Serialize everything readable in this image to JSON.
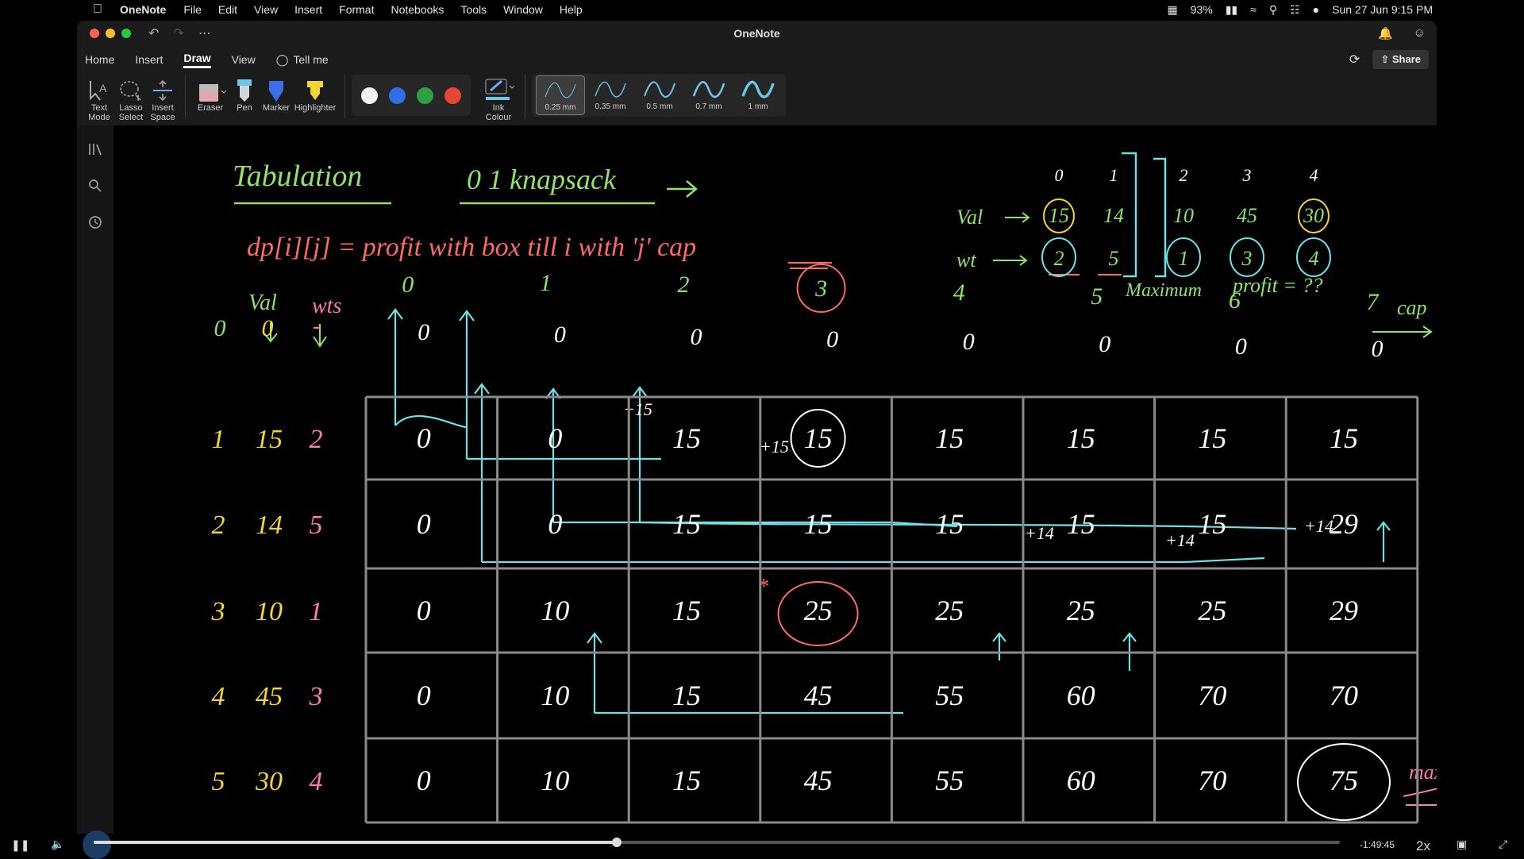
{
  "menubar": {
    "app_name": "OneNote",
    "items": [
      "File",
      "Edit",
      "View",
      "Insert",
      "Format",
      "Notebooks",
      "Tools",
      "Window",
      "Help"
    ],
    "battery": "93%",
    "datetime": "Sun 27 Jun  9:15 PM"
  },
  "window": {
    "title": "OneNote",
    "tabs": [
      "Home",
      "Insert",
      "Draw",
      "View"
    ],
    "active_tab": "Draw",
    "tell_me": "Tell me",
    "share": "Share"
  },
  "ribbon": {
    "text_mode": [
      "Text",
      "Mode"
    ],
    "lasso_select": [
      "Lasso",
      "Select"
    ],
    "insert_space": [
      "Insert",
      "Space"
    ],
    "eraser": "Eraser",
    "pen": "Pen",
    "marker": "Marker",
    "highlighter": "Highlighter",
    "ink_colour": [
      "Ink",
      "Colour"
    ],
    "colors": [
      "#f2f2f2",
      "#2f6fe6",
      "#2ea043",
      "#e8472f"
    ],
    "pen_widths": [
      "0.25 mm",
      "0.35 mm",
      "0.5 mm",
      "0.7 mm",
      "1 mm"
    ],
    "selected_width": "0.25 mm"
  },
  "note": {
    "heading": "Tabulation",
    "subheading": "0 1 knapsack",
    "definition": "dp[i][j] = profit with box till i with 'j' cap",
    "items_panel": {
      "indices": [
        "0",
        "1",
        "2",
        "3",
        "4"
      ],
      "val_label": "Val",
      "wt_label": "wt",
      "values": [
        "15",
        "14",
        "10",
        "45",
        "30"
      ],
      "weights": [
        "2",
        "5",
        "1",
        "3",
        "4"
      ],
      "question": [
        "Maximum",
        "profit = ??"
      ]
    },
    "table": {
      "row_header_val": "Val",
      "row_header_wt": "wts",
      "cap_label": "cap",
      "capacities": [
        "0",
        "1",
        "2",
        "3",
        "4",
        "5",
        "6",
        "7"
      ],
      "base_row": {
        "index": "0",
        "val": "0",
        "wt": "-",
        "cells": [
          "0",
          "0",
          "0",
          "0",
          "0",
          "0",
          "0",
          "0"
        ]
      },
      "rows": [
        {
          "index": "1",
          "val": "15",
          "wt": "2",
          "cells": [
            "0",
            "0",
            "15",
            "15",
            "15",
            "15",
            "15",
            "15"
          ]
        },
        {
          "index": "2",
          "val": "14",
          "wt": "5",
          "cells": [
            "0",
            "0",
            "15",
            "15",
            "15",
            "15",
            "15",
            "29"
          ]
        },
        {
          "index": "3",
          "val": "10",
          "wt": "1",
          "cells": [
            "0",
            "10",
            "15",
            "25",
            "25",
            "25",
            "25",
            "29"
          ]
        },
        {
          "index": "4",
          "val": "45",
          "wt": "3",
          "cells": [
            "0",
            "10",
            "15",
            "45",
            "55",
            "60",
            "70",
            "70"
          ]
        },
        {
          "index": "5",
          "val": "30",
          "wt": "4",
          "cells": [
            "0",
            "10",
            "15",
            "45",
            "55",
            "60",
            "70",
            "75"
          ]
        }
      ],
      "annotations": {
        "plus15": "+15",
        "plus14": "+14",
        "star": "*",
        "max": "max"
      }
    }
  },
  "player": {
    "remaining": "-1:49:45",
    "speed": "2x",
    "progress": 0.42
  }
}
